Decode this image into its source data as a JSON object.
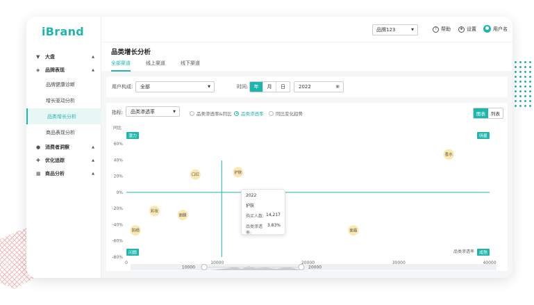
{
  "app": {
    "logo": "iBrand"
  },
  "topbar": {
    "brand_value": "品牌123",
    "help": "帮助",
    "settings": "设置",
    "user": "用户名"
  },
  "sidebar": {
    "items": [
      {
        "label": "大盘",
        "type": "group",
        "icon": "dashboard-icon"
      },
      {
        "label": "品牌表现",
        "type": "group",
        "icon": "layers-icon"
      },
      {
        "label": "品牌健康诊断",
        "type": "sub"
      },
      {
        "label": "增长驱动分析",
        "type": "sub"
      },
      {
        "label": "品类增长分析",
        "type": "sub",
        "active": true
      },
      {
        "label": "商品表现分析",
        "type": "sub"
      },
      {
        "label": "消费者洞察",
        "type": "group",
        "icon": "user-icon"
      },
      {
        "label": "优化追踪",
        "type": "group",
        "icon": "target-icon"
      },
      {
        "label": "商品分析",
        "type": "group",
        "icon": "grid-icon"
      }
    ]
  },
  "page": {
    "title": "品类增长分析",
    "tabs": [
      "全部渠道",
      "线上渠道",
      "线下渠道"
    ],
    "active_tab": 0
  },
  "filters": {
    "user_label": "用户构成:",
    "user_value": "全部",
    "time_label": "时间:",
    "periods": [
      "年",
      "月",
      "日"
    ],
    "active_period": 0,
    "date_value": "2022"
  },
  "metric": {
    "label": "指标:",
    "value": "品类渗透率",
    "radios": [
      "品类渗透率&同比",
      "品类渗透率",
      "同比变化趋势"
    ],
    "active_radio": 1,
    "views": [
      "图表",
      "列表"
    ],
    "active_view": 0
  },
  "tooltip": {
    "year": "2022",
    "name": "护肤",
    "buyers_label": "购买人数:",
    "buyers_value": "14,217",
    "rate_label": "品类渗透率:",
    "rate_value": "3.83%"
  },
  "colors": {
    "accent": "#1fb5ad",
    "bubble": "#fbe8b0"
  },
  "chart_data": {
    "type": "scatter",
    "ylabel": "同比",
    "xlabel": "品类渗透率",
    "xlim": [
      0,
      40000
    ],
    "ylim": [
      -80,
      60
    ],
    "x_ticks": [
      "0",
      "10000",
      "20000",
      "30000",
      "40000"
    ],
    "y_ticks": [
      "60%",
      "40%",
      "20%",
      "0%",
      "-20%",
      "-40%",
      "-60%",
      "-80%"
    ],
    "x_ref": 10500,
    "y_ref": 0,
    "quadrants": [
      "潜力",
      "明星",
      "问题",
      "成熟"
    ],
    "points": [
      {
        "name": "口红",
        "x": 7600,
        "y": 22
      },
      {
        "name": "护肤",
        "x": 12300,
        "y": 25
      },
      {
        "name": "香水",
        "x": 35500,
        "y": 47
      },
      {
        "name": "彩妆",
        "x": 3100,
        "y": -23
      },
      {
        "name": "面膜",
        "x": 6200,
        "y": -28
      },
      {
        "name": "防晒",
        "x": 1000,
        "y": -47
      },
      {
        "name": "面霜",
        "x": 25000,
        "y": -47
      }
    ],
    "range": {
      "from": "10000",
      "to": "20000"
    }
  }
}
